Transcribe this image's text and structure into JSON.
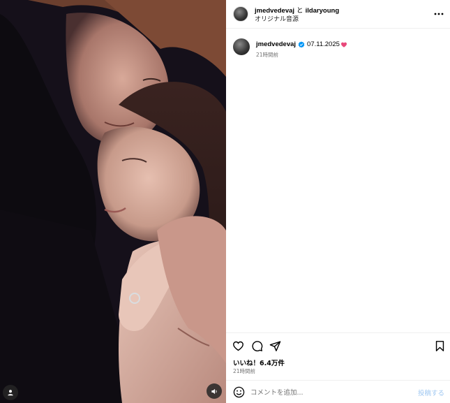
{
  "media": {
    "user_icon": "user-tag-icon",
    "sound_icon": "speaker-icon"
  },
  "header": {
    "author": "jmedvedevaj",
    "connector": "と",
    "collaborator": "ildaryoung",
    "audio": "オリジナル音源",
    "more_icon": "more-horizontal-icon"
  },
  "caption": {
    "username": "jmedvedevaj",
    "verified_icon": "verified-badge-icon",
    "text": "07.11.2025",
    "emoji": "pink-heart-icon",
    "time": "21時間前"
  },
  "actions": {
    "icons": [
      "heart-icon",
      "comment-icon",
      "share-icon",
      "bookmark-icon"
    ],
    "likes": "いいね！6.4万件",
    "time": "21時間前"
  },
  "comment": {
    "emoji_icon": "smiley-icon",
    "placeholder": "コメントを追加...",
    "post_label": "投稿する"
  },
  "colors": {
    "accent_blue": "#0095f6",
    "verified_blue": "#0095f6",
    "heart_pink": "#e8487a",
    "muted_text": "#737373",
    "post_disabled": "#a0c8f2"
  }
}
